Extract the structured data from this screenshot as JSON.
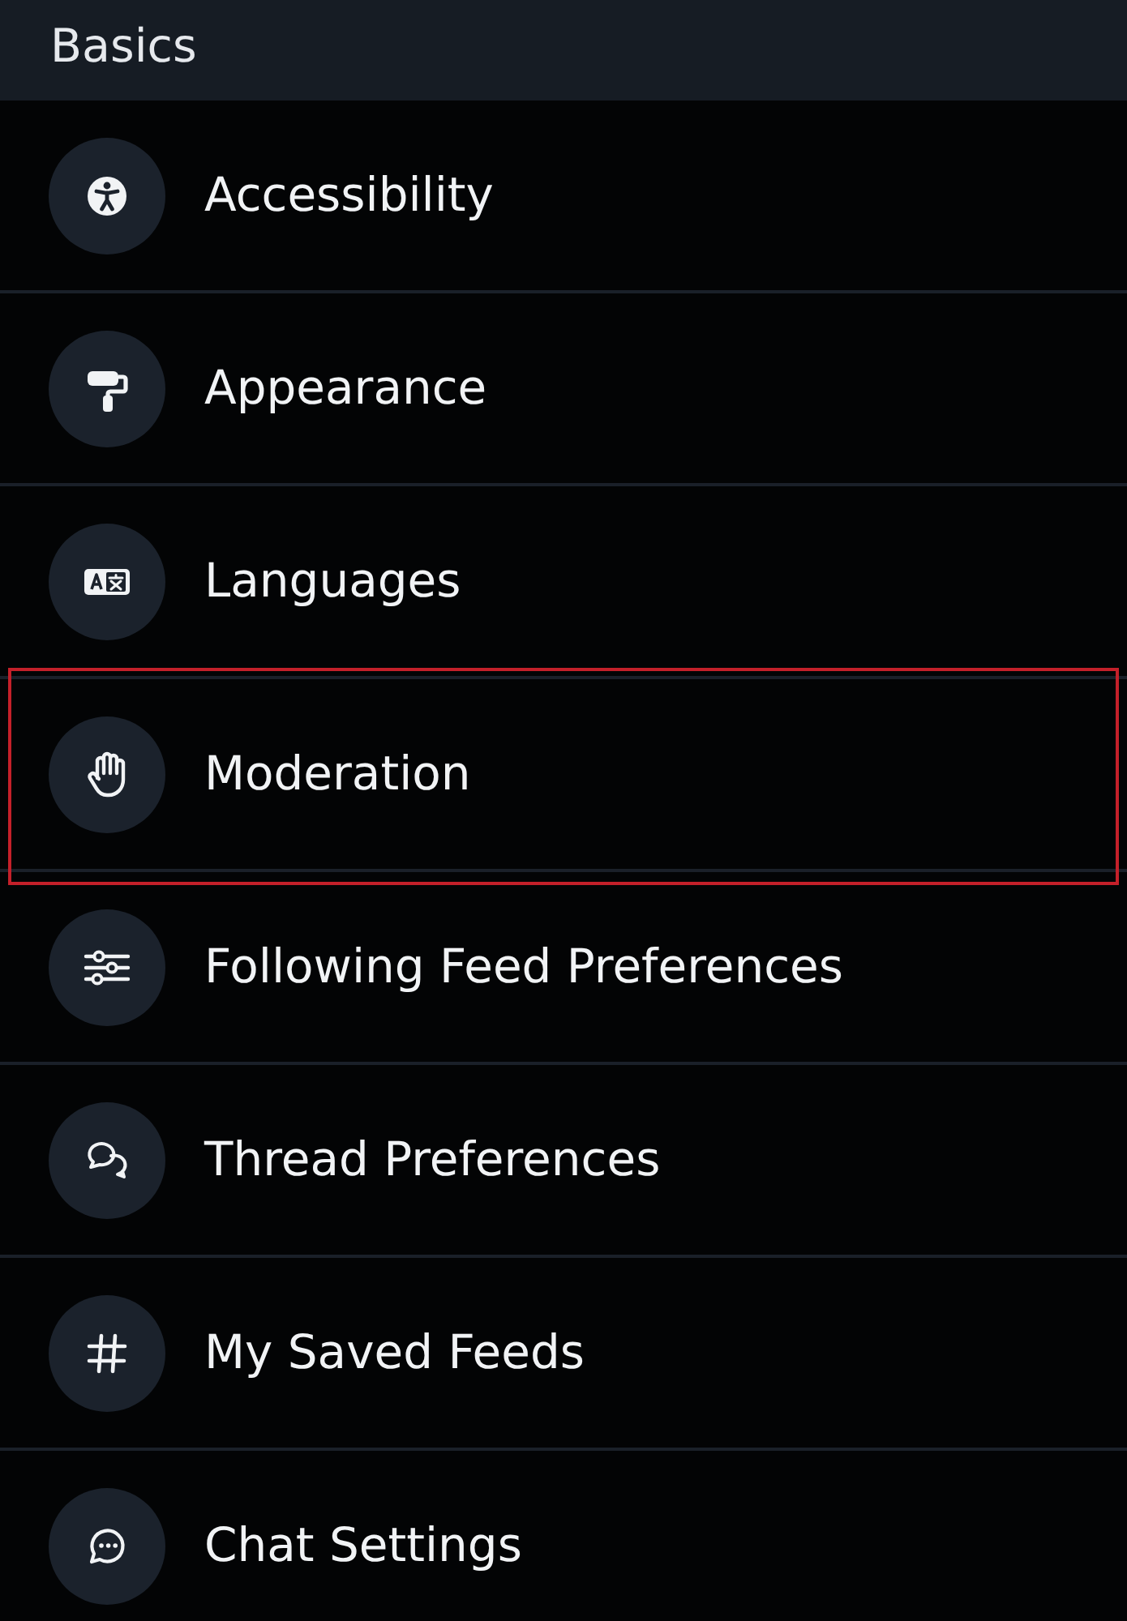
{
  "section": {
    "title": "Basics"
  },
  "items": [
    {
      "label": "Accessibility",
      "highlighted": false
    },
    {
      "label": "Appearance",
      "highlighted": false
    },
    {
      "label": "Languages",
      "highlighted": false
    },
    {
      "label": "Moderation",
      "highlighted": true
    },
    {
      "label": "Following Feed Preferences",
      "highlighted": false
    },
    {
      "label": "Thread Preferences",
      "highlighted": false
    },
    {
      "label": "My Saved Feeds",
      "highlighted": false
    },
    {
      "label": "Chat Settings",
      "highlighted": false
    }
  ]
}
